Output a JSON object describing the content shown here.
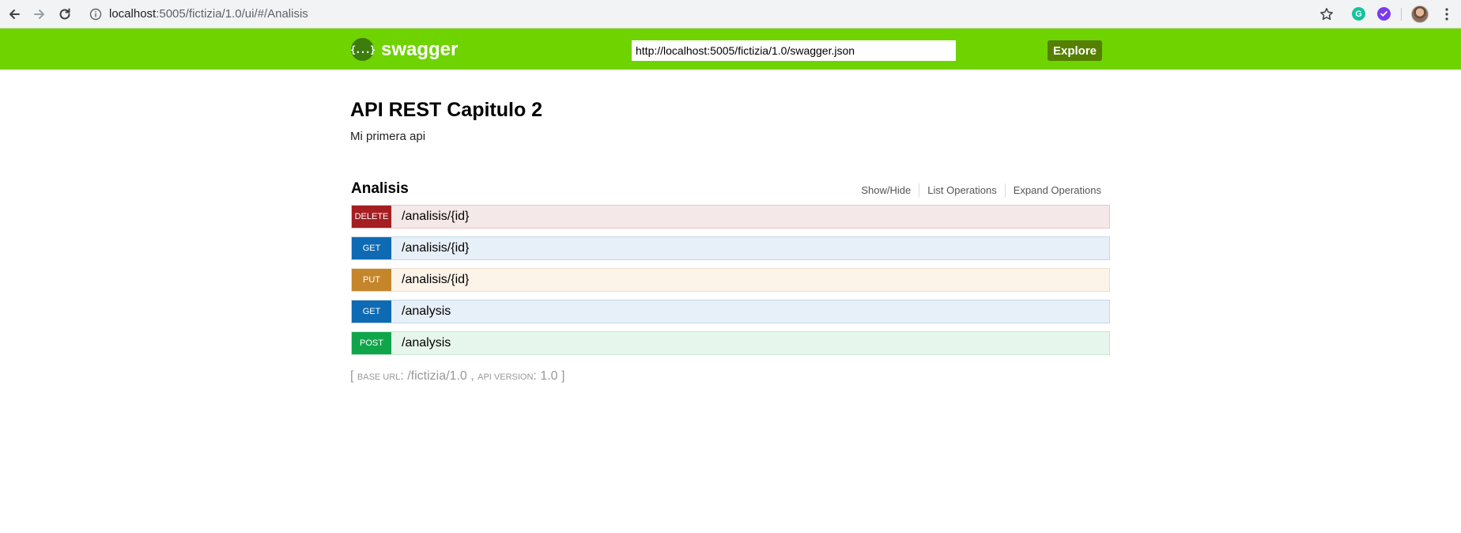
{
  "browser": {
    "address_host": "localhost",
    "address_path": ":5005/fictizia/1.0/ui/#/Analisis",
    "extensions": [
      "grammarly-icon",
      "purple-check-icon"
    ]
  },
  "header": {
    "logo_text": "swagger",
    "logo_icon_glyph": "{...}",
    "spec_url": "http://localhost:5005/fictizia/1.0/swagger.json",
    "explore_label": "Explore",
    "background_color": "#6fd300"
  },
  "info": {
    "title": "API REST Capitulo 2",
    "description": "Mi primera api"
  },
  "resource": {
    "name": "Analisis",
    "options": [
      {
        "label": "Show/Hide"
      },
      {
        "label": "List Operations"
      },
      {
        "label": "Expand Operations"
      }
    ],
    "operations": [
      {
        "method": "DELETE",
        "path": "/analisis/{id}",
        "color": "#a41e22"
      },
      {
        "method": "GET",
        "path": "/analisis/{id}",
        "color": "#0f6ab4"
      },
      {
        "method": "PUT",
        "path": "/analisis/{id}",
        "color": "#c5862b"
      },
      {
        "method": "GET",
        "path": "/analysis",
        "color": "#0f6ab4"
      },
      {
        "method": "POST",
        "path": "/analysis",
        "color": "#10a54a"
      }
    ]
  },
  "footer": {
    "open_bracket": "[ ",
    "base_url_label": "base url",
    "base_url_value": ": /fictizia/1.0 , ",
    "api_version_label": "api version",
    "api_version_value": ": 1.0 ",
    "close_bracket": "]"
  }
}
